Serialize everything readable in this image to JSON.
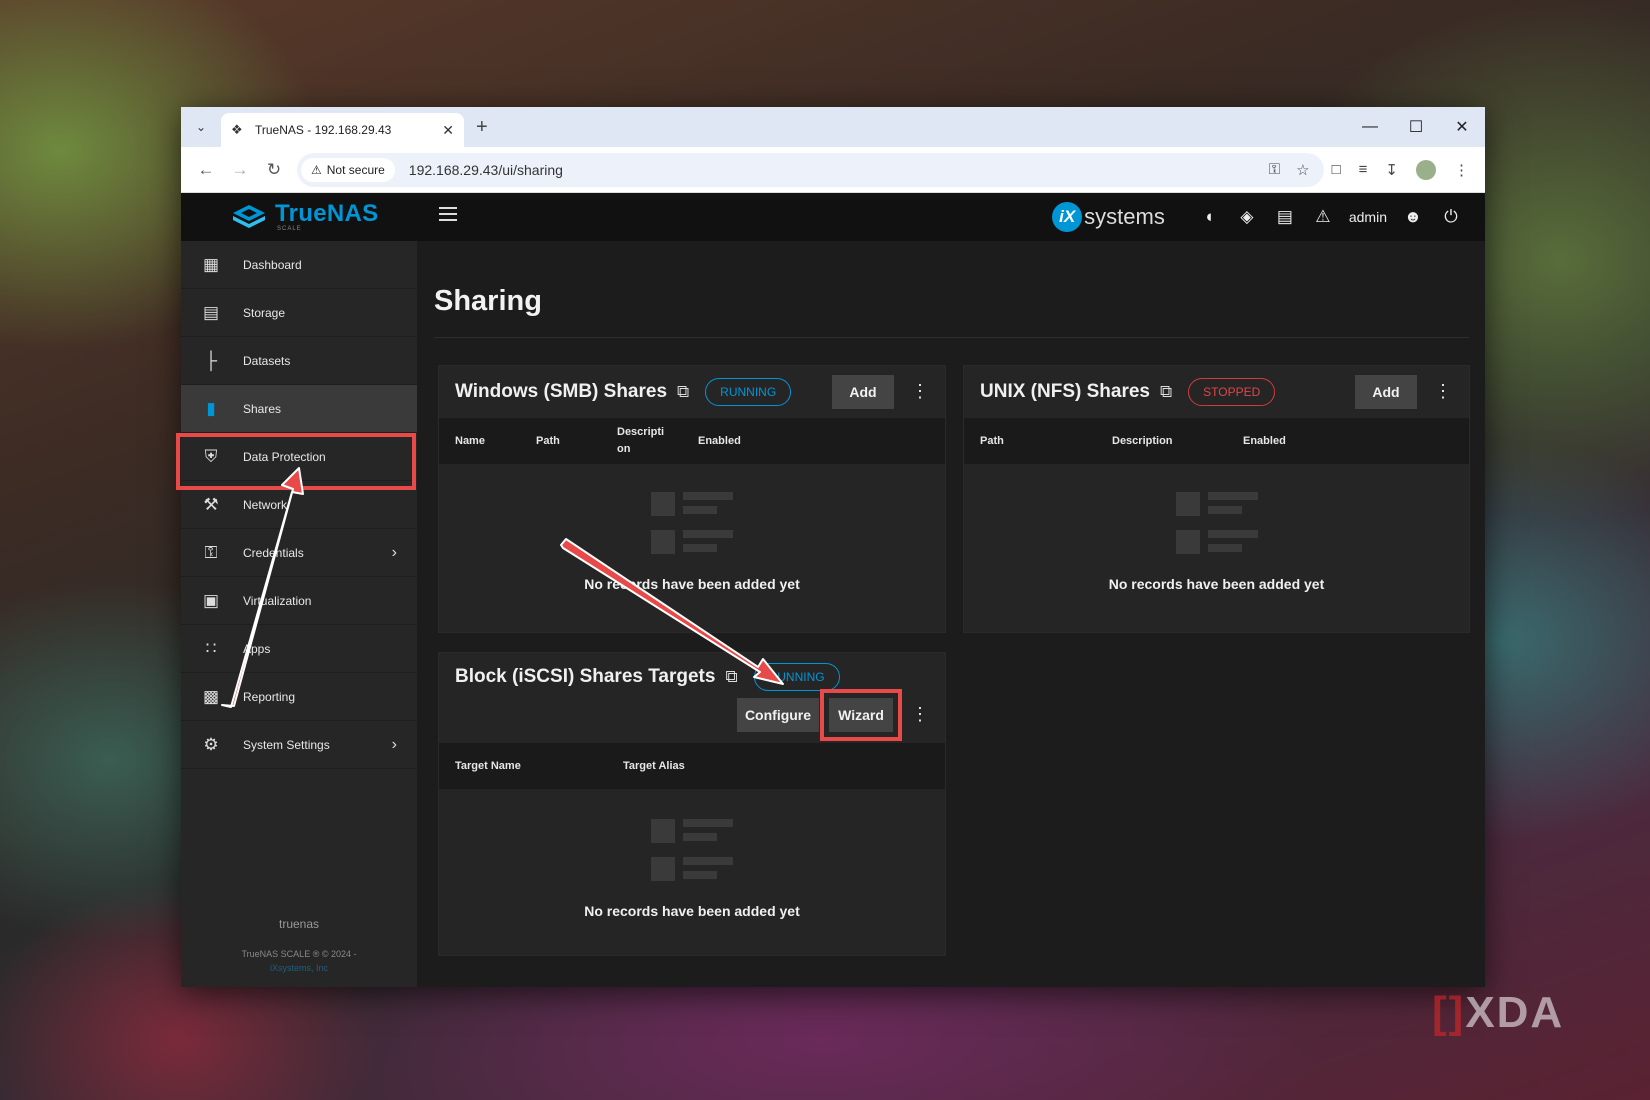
{
  "browser": {
    "tab_title": "TrueNAS - 192.168.29.43",
    "security_label": "Not secure",
    "url": "192.168.29.43/ui/sharing"
  },
  "app": {
    "logo_text": "TrueNAS",
    "logo_sub": "SCALE",
    "vendor": "systems",
    "user": "admin"
  },
  "sidebar": {
    "items": [
      {
        "label": "Dashboard",
        "icon": "dashboard-icon"
      },
      {
        "label": "Storage",
        "icon": "storage-icon"
      },
      {
        "label": "Datasets",
        "icon": "datasets-icon"
      },
      {
        "label": "Shares",
        "icon": "shares-icon",
        "active": true
      },
      {
        "label": "Data Protection",
        "icon": "shield-icon"
      },
      {
        "label": "Network",
        "icon": "network-icon"
      },
      {
        "label": "Credentials",
        "icon": "key-icon"
      },
      {
        "label": "Virtualization",
        "icon": "laptop-icon"
      },
      {
        "label": "Apps",
        "icon": "apps-grid-icon"
      },
      {
        "label": "Reporting",
        "icon": "reporting-icon"
      },
      {
        "label": "System Settings",
        "icon": "gear-icon"
      }
    ],
    "hostname": "truenas",
    "copyright": "TrueNAS SCALE ® © 2024 -",
    "company": "iXsystems, Inc"
  },
  "main": {
    "title": "Sharing",
    "smb": {
      "title": "Windows (SMB) Shares",
      "status": "RUNNING",
      "add": "Add",
      "columns": [
        "Name",
        "Path",
        "Descripti on",
        "Enabled"
      ],
      "empty": "No records have been added yet"
    },
    "nfs": {
      "title": "UNIX (NFS) Shares",
      "status": "STOPPED",
      "add": "Add",
      "columns": [
        "Path",
        "Description",
        "Enabled"
      ],
      "empty": "No records have been added yet"
    },
    "iscsi": {
      "title": "Block (iSCSI) Shares Targets",
      "status": "RUNNING",
      "configure": "Configure",
      "wizard": "Wizard",
      "columns": [
        "Target Name",
        "Target Alias"
      ],
      "empty": "No records have been added yet"
    }
  },
  "watermark": "XDA",
  "colors": {
    "accent": "#0095d5",
    "stopped": "#e04545",
    "highlight": "#e84a4a"
  }
}
